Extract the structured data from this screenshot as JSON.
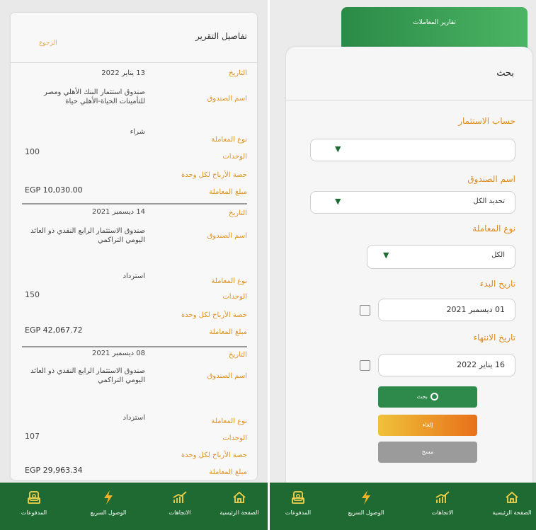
{
  "left": {
    "header_title": "تفاصيل التقرير",
    "back_label": "الرجوع",
    "labels": {
      "date": "التاريخ",
      "fund": "اسم الصندوق",
      "type": "نوع المعاملة",
      "units": "الوحدات",
      "profit_share": "حصة الأرباح لكل وحدة",
      "amount": "مبلغ المعاملة"
    },
    "records": [
      {
        "date": "13 يناير 2022",
        "fund": "صندوق استثمار البنك الأهلي ومصر للتأمينات الحياة-الأهلي حياة",
        "type": "شراء",
        "units": "100",
        "amount": "EGP 10,030.00"
      },
      {
        "date": "14 ديسمبر 2021",
        "fund": "صندوق الاستثمار الرابع النقدي ذو العائد اليومي التراكمي",
        "type": "استرداد",
        "units": "150",
        "amount": "EGP 42,067.72"
      },
      {
        "date": "08 ديسمبر 2021",
        "fund": "صندوق الاستثمار الرابع النقدي ذو العائد اليومي التراكمي",
        "type": "استرداد",
        "units": "107",
        "amount": "EGP 29,963.34"
      }
    ]
  },
  "right": {
    "tab_label": "تقارير المعاملات",
    "search_title": "بحث",
    "account_label": "حساب الاستثمار",
    "account_value": "",
    "fund_label": "اسم الصندوق",
    "fund_value": "تحديد الكل",
    "type_label": "نوع المعاملة",
    "type_value": "الكل",
    "start_label": "تاريخ البدء",
    "start_value": "01 ديسمبر 2021",
    "end_label": "تاريخ الانتهاء",
    "end_value": "16 يناير 2022",
    "search_button": "بحث",
    "cancel_button": "إلغاء",
    "clear_button": "مسح"
  },
  "nav": {
    "home": "الصفحة الرئيسية",
    "trends": "الاتجاهات",
    "quick_access": "الوصول السريع",
    "payments": "المدفوعات"
  },
  "colors": {
    "nav_bg": "#1f6a32",
    "accent_orange": "#e2921f",
    "tab_green": "#3aa055"
  }
}
